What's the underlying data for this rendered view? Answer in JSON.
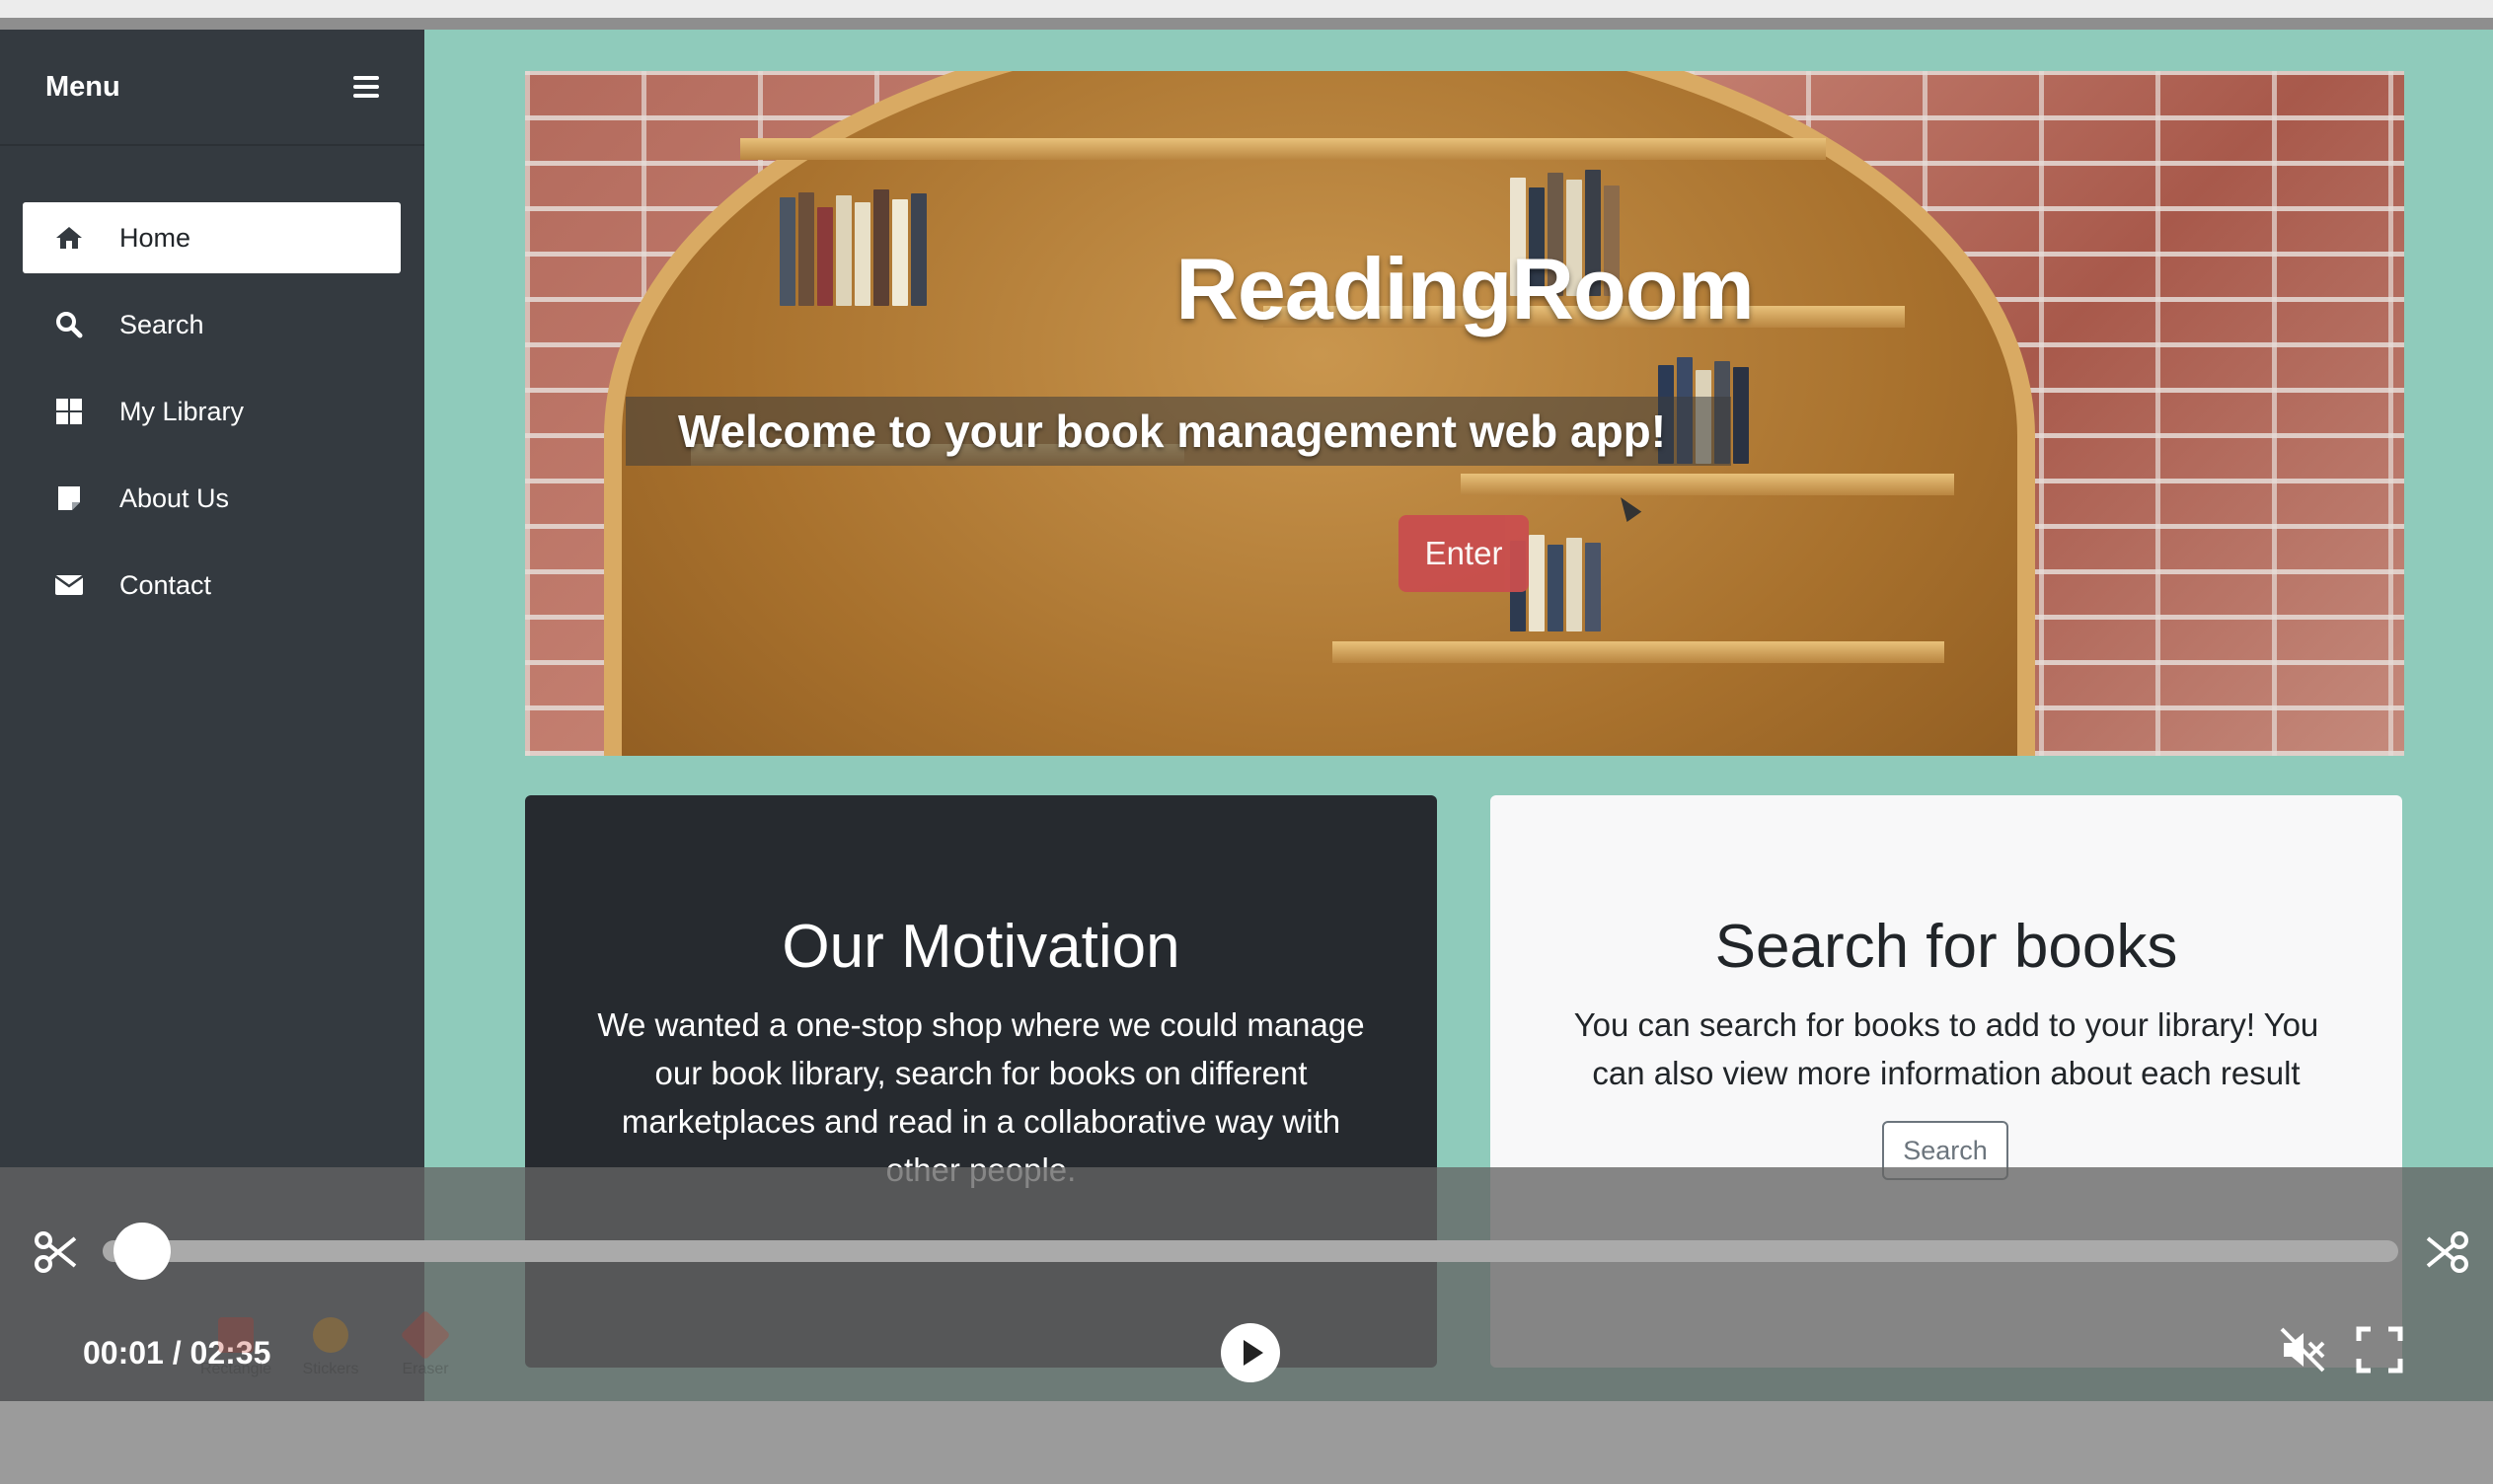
{
  "sidebar": {
    "title": "Menu",
    "items": [
      {
        "label": "Home",
        "icon": "home-icon",
        "active": true
      },
      {
        "label": "Search",
        "icon": "search-icon",
        "active": false
      },
      {
        "label": "My Library",
        "icon": "grid-icon",
        "active": false
      },
      {
        "label": "About Us",
        "icon": "note-icon",
        "active": false
      },
      {
        "label": "Contact",
        "icon": "envelope-icon",
        "active": false
      }
    ]
  },
  "hero": {
    "title": "ReadingRoom",
    "subtitle": "Welcome to your book management web app!",
    "enter_label": "Enter"
  },
  "cards": {
    "motivation": {
      "title": "Our Motivation",
      "text": "We wanted a one-stop shop where we could manage our book library, search for books on different marketplaces and read in a collaborative way with other people."
    },
    "search": {
      "title": "Search for books",
      "text": "You can search for books to add to your library! You can also view more information about each result",
      "button_label": "Search"
    }
  },
  "player": {
    "current_time": "00:01",
    "total_time": "02:35",
    "time_display": "00:01 / 02:35",
    "progress": 0.006,
    "muted": true
  },
  "toolbar": {
    "tools": [
      "Rectangle",
      "Stickers",
      "Eraser"
    ]
  },
  "colors": {
    "sidebar_bg": "#343a40",
    "page_bg": "#8fcbbb",
    "enter_button": "#c94e4e",
    "card_dark": "#262a2f",
    "card_light": "#f8f8f9"
  }
}
